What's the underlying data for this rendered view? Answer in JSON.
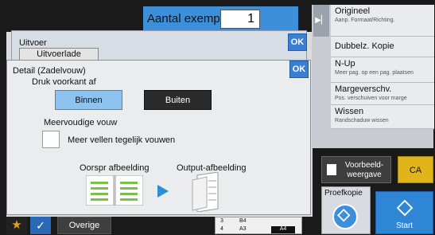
{
  "header": {
    "copies_label": "Aantal exempl.",
    "copies_value": "1"
  },
  "sidebar": {
    "items": [
      {
        "title": "Origineel",
        "sub": "Aanp. Formaat/Richting."
      },
      {
        "title": "Dubbelz. Kopie",
        "sub": ""
      },
      {
        "title": "N-Up",
        "sub": "Meer pag. op een pag. plaatsen"
      },
      {
        "title": "Margeverschv.",
        "sub": "Pos. verschuiven voor marge"
      },
      {
        "title": "Wissen",
        "sub": "Randschaduw wissen"
      }
    ]
  },
  "uitvoer": {
    "title": "Uitvoer",
    "tray_label": "Uitvoerlade",
    "ok_label": "OK"
  },
  "detail": {
    "title": "Detail (Zadelvouw)",
    "ok_label": "OK",
    "print_front_label": "Druk voorkant af",
    "option_inside": "Binnen",
    "option_outside": "Buiten",
    "multi_fold_label": "Meervoudige vouw",
    "multi_sheets_label": "Meer vellen tegelijk vouwen",
    "multi_sheets_checked": false,
    "original_image_label": "Oorspr afbeelding",
    "output_image_label": "Output-afbeelding"
  },
  "bottom": {
    "other_label": "Overige",
    "paper_rows": [
      {
        "num": "3",
        "size": "B4"
      },
      {
        "num": "4",
        "size": "A3"
      }
    ],
    "paper_selected": "A4"
  },
  "actions": {
    "preview_label": "Voorbeeld-weergave",
    "ca_label": "CA",
    "proof_label": "Proefkopie",
    "start_label": "Start"
  },
  "colors": {
    "accent": "#3c7fd1",
    "selected": "#8ec3ef",
    "ca": "#e0b51a"
  }
}
